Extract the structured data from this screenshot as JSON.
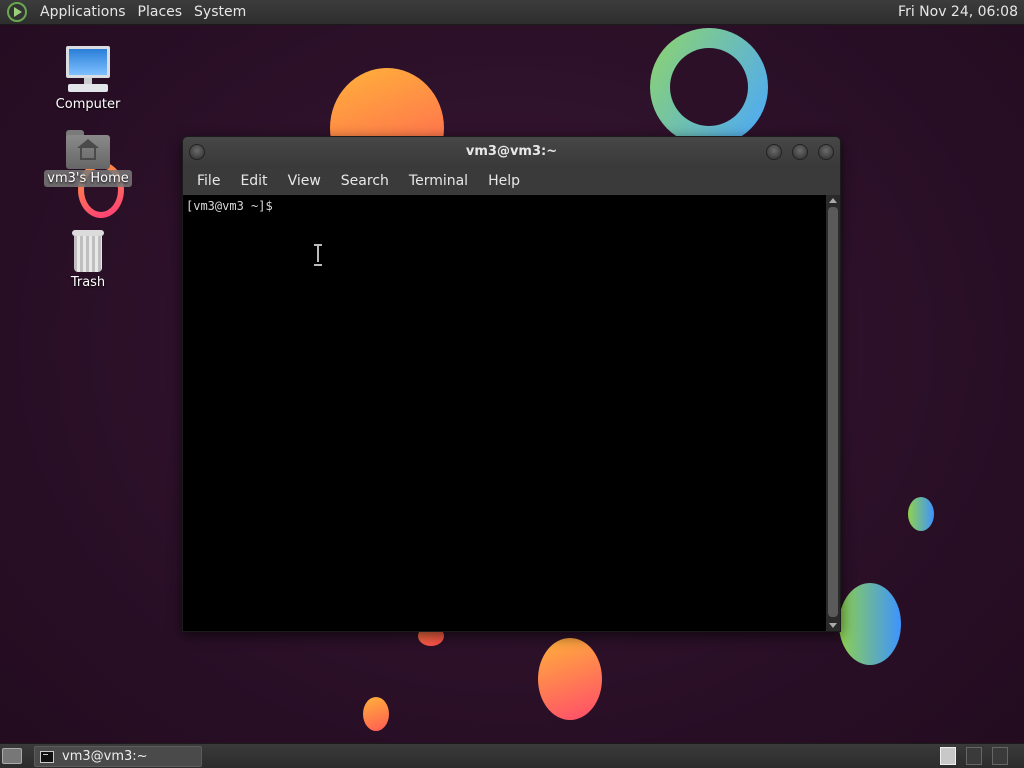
{
  "top_panel": {
    "menus": [
      "Applications",
      "Places",
      "System"
    ],
    "clock": "Fri Nov 24, 06:08"
  },
  "desktop": {
    "icons": [
      {
        "label": "Computer"
      },
      {
        "label": "vm3's Home"
      },
      {
        "label": "Trash"
      }
    ]
  },
  "terminal": {
    "title": "vm3@vm3:~",
    "menus": [
      "File",
      "Edit",
      "View",
      "Search",
      "Terminal",
      "Help"
    ],
    "prompt": "[vm3@vm3 ~]$"
  },
  "taskbar": {
    "window_label": "vm3@vm3:~"
  }
}
